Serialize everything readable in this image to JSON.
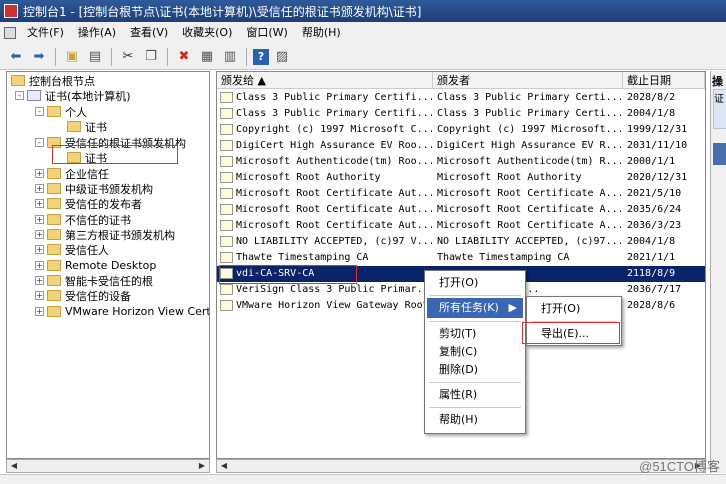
{
  "window": {
    "title": "控制台1 - [控制台根节点\\证书(本地计算机)\\受信任的根证书颁发机构\\证书]"
  },
  "menubar": {
    "items": [
      "文件(F)",
      "操作(A)",
      "查看(V)",
      "收藏夹(O)",
      "窗口(W)",
      "帮助(H)"
    ]
  },
  "toolbar": {
    "icons": [
      "back-arrow-icon",
      "forward-arrow-icon",
      "up-folder-icon",
      "show-tree-icon",
      "cut-icon",
      "copy-icon",
      "delete-icon",
      "properties-icon",
      "export-list-icon",
      "help-icon",
      "toggle-pane-icon"
    ]
  },
  "tree": {
    "items": [
      {
        "label": "控制台根节点",
        "indent": 0,
        "expander": ""
      },
      {
        "label": "证书(本地计算机)",
        "indent": 1,
        "expander": "-"
      },
      {
        "label": "个人",
        "indent": 2,
        "expander": "-"
      },
      {
        "label": "证书",
        "indent": 3,
        "expander": ""
      },
      {
        "label": "受信任的根证书颁发机构",
        "indent": 2,
        "expander": "-"
      },
      {
        "label": "证书",
        "indent": 3,
        "expander": ""
      },
      {
        "label": "企业信任",
        "indent": 2,
        "expander": "+"
      },
      {
        "label": "中级证书颁发机构",
        "indent": 2,
        "expander": "+"
      },
      {
        "label": "受信任的发布者",
        "indent": 2,
        "expander": "+"
      },
      {
        "label": "不信任的证书",
        "indent": 2,
        "expander": "+"
      },
      {
        "label": "第三方根证书颁发机构",
        "indent": 2,
        "expander": "+"
      },
      {
        "label": "受信任人",
        "indent": 2,
        "expander": "+"
      },
      {
        "label": "Remote Desktop",
        "indent": 2,
        "expander": "+"
      },
      {
        "label": "智能卡受信任的根",
        "indent": 2,
        "expander": "+"
      },
      {
        "label": "受信任的设备",
        "indent": 2,
        "expander": "+"
      },
      {
        "label": "VMware Horizon View Certi",
        "indent": 2,
        "expander": "+"
      }
    ]
  },
  "list": {
    "columns": [
      "颁发给 ▲",
      "颁发者",
      "截止日期"
    ],
    "rows": [
      {
        "to": "Class 3 Public Primary Certifi...",
        "by": "Class 3 Public Primary Certi...",
        "exp": "2028/8/2"
      },
      {
        "to": "Class 3 Public Primary Certifi...",
        "by": "Class 3 Public Primary Certi...",
        "exp": "2004/1/8"
      },
      {
        "to": "Copyright (c) 1997 Microsoft C...",
        "by": "Copyright (c) 1997 Microsoft...",
        "exp": "1999/12/31"
      },
      {
        "to": "DigiCert High Assurance EV Roo...",
        "by": "DigiCert High Assurance EV R...",
        "exp": "2031/11/10"
      },
      {
        "to": "Microsoft Authenticode(tm) Roo...",
        "by": "Microsoft Authenticode(tm) R...",
        "exp": "2000/1/1"
      },
      {
        "to": "Microsoft Root Authority",
        "by": "Microsoft Root Authority",
        "exp": "2020/12/31"
      },
      {
        "to": "Microsoft Root Certificate Aut...",
        "by": "Microsoft Root Certificate A...",
        "exp": "2021/5/10"
      },
      {
        "to": "Microsoft Root Certificate Aut...",
        "by": "Microsoft Root Certificate A...",
        "exp": "2035/6/24"
      },
      {
        "to": "Microsoft Root Certificate Aut...",
        "by": "Microsoft Root Certificate A...",
        "exp": "2036/3/23"
      },
      {
        "to": "NO LIABILITY ACCEPTED, (c)97 V...",
        "by": "NO LIABILITY ACCEPTED, (c)97...",
        "exp": "2004/1/8"
      },
      {
        "to": "Thawte Timestamping CA",
        "by": "Thawte Timestamping CA",
        "exp": "2021/1/1"
      },
      {
        "to": "vdi-CA-SRV-CA",
        "by": "",
        "exp": "2118/8/9"
      },
      {
        "to": "VeriSign Class 3 Public Primar...",
        "by": "3 Public Prima...",
        "exp": "2036/7/17"
      },
      {
        "to": "VMware Horizon View Gateway Root",
        "by": "",
        "exp": "2028/8/6"
      }
    ]
  },
  "context_menu": {
    "items": [
      "打开(O)",
      "所有任务(K)",
      "剪切(T)",
      "复制(C)",
      "删除(D)",
      "属性(R)",
      "帮助(H)"
    ],
    "submenu": [
      "打开(O)",
      "导出(E)..."
    ]
  },
  "actions_pane": {
    "title": "操",
    "item": "证"
  },
  "watermark": "@51CTO博客"
}
